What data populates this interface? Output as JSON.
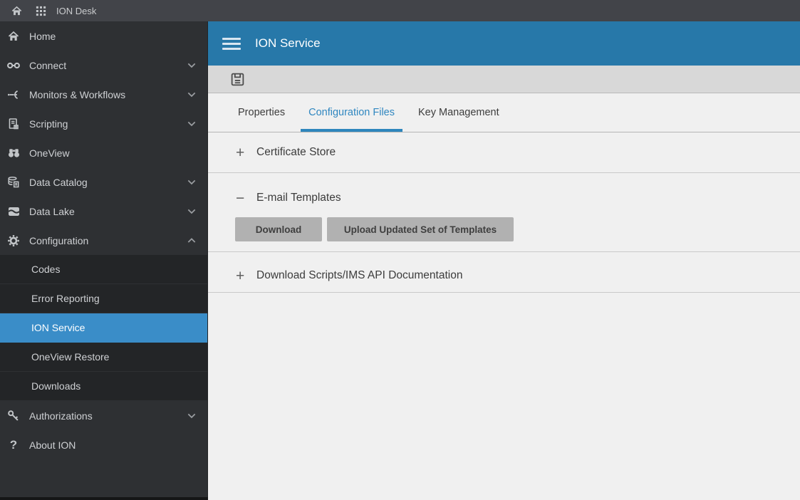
{
  "topbar": {
    "app_title": "ION Desk"
  },
  "sidebar": {
    "items": [
      {
        "label": "Home",
        "icon": "home",
        "expandable": false
      },
      {
        "label": "Connect",
        "icon": "connect",
        "expandable": true
      },
      {
        "label": "Monitors & Workflows",
        "icon": "workflow",
        "expandable": true
      },
      {
        "label": "Scripting",
        "icon": "scripting",
        "expandable": true
      },
      {
        "label": "OneView",
        "icon": "binoculars",
        "expandable": false
      },
      {
        "label": "Data Catalog",
        "icon": "data-catalog",
        "expandable": true
      },
      {
        "label": "Data Lake",
        "icon": "data-lake",
        "expandable": true
      },
      {
        "label": "Configuration",
        "icon": "gear",
        "expandable": true,
        "expanded": true
      }
    ],
    "submenu": [
      {
        "label": "Codes",
        "selected": false
      },
      {
        "label": "Error Reporting",
        "selected": false
      },
      {
        "label": "ION Service",
        "selected": true
      },
      {
        "label": "OneView Restore",
        "selected": false
      },
      {
        "label": "Downloads",
        "selected": false
      }
    ],
    "footer_items": [
      {
        "label": "Authorizations",
        "icon": "key",
        "expandable": true
      },
      {
        "label": "About ION",
        "icon": "help",
        "expandable": false
      }
    ]
  },
  "header": {
    "title": "ION Service",
    "menu_icon": "hamburger-icon"
  },
  "toolbar": {
    "save_icon": "save-floppy-icon"
  },
  "tabs": [
    {
      "label": "Properties",
      "active": false
    },
    {
      "label": "Configuration Files",
      "active": true
    },
    {
      "label": "Key Management",
      "active": false
    }
  ],
  "sections": [
    {
      "title": "Certificate Store",
      "state": "collapsed",
      "toggle_glyph": "+"
    },
    {
      "title": "E-mail Templates",
      "state": "expanded",
      "toggle_glyph": "−",
      "buttons": [
        {
          "label": "Download"
        },
        {
          "label": "Upload Updated Set of Templates"
        }
      ]
    },
    {
      "title": "Download Scripts/IMS API Documentation",
      "state": "collapsed",
      "toggle_glyph": "+"
    }
  ],
  "help_glyph": "?",
  "colors": {
    "topbar_bg": "#424449",
    "sidebar_bg": "#2e3033",
    "submenu_bg": "#232527",
    "selected_item_blue": "#3a8dc8",
    "header_blue": "#2778a9",
    "active_tab_blue": "#2e86bd",
    "toolbar_bg": "#d8d8d8",
    "content_bg": "#f0f0f0",
    "button_bg": "#b1b1b1"
  }
}
